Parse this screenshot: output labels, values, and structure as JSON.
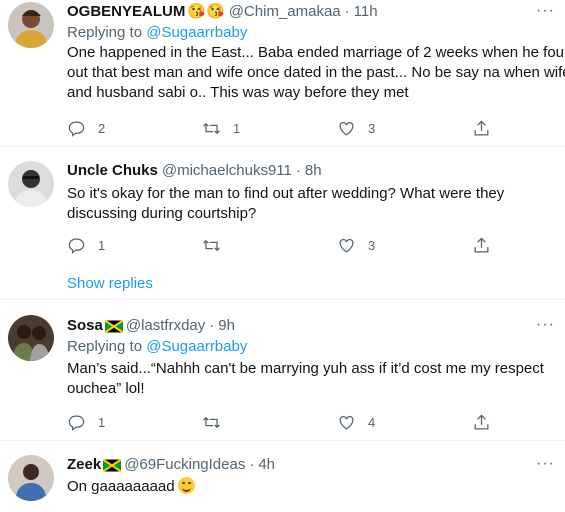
{
  "tweets": [
    {
      "name": "OGBENYEALUM",
      "name_emoji": "😘😘",
      "handle": "@Chim_amakaa",
      "time": "11h",
      "replying_label": "Replying to",
      "replying_to": "@Sugaarrbaby",
      "text_lines": [
        "One happened in the East... Baba ended marriage of 2 weeks when he found",
        "out that best man and wife once dated in the past... No be say na when wife",
        "and husband sabi o.. This was way before they met"
      ],
      "replies": "2",
      "retweets": "1",
      "likes": "3"
    },
    {
      "name": "Uncle Chuks",
      "handle": "@michaelchuks911",
      "time": "8h",
      "text_lines": [
        "So it's okay for the man to find out after wedding? What were they",
        "discussing during courtship?"
      ],
      "replies": "1",
      "retweets": "",
      "likes": "3",
      "show_replies": "Show replies"
    },
    {
      "name": "Sosa",
      "handle": "@lastfrxday",
      "time": "9h",
      "replying_label": "Replying to",
      "replying_to": "@Sugaarrbaby",
      "text_lines": [
        "Man’s said...“Nahhh can't be marrying yuh ass if it’d cost me my respect",
        "ouchea” lol!"
      ],
      "replies": "1",
      "retweets": "",
      "likes": "4"
    },
    {
      "name": "Zeek",
      "handle": "@69FuckingIdeas",
      "time": "4h",
      "text_lines": [
        "On gaaaaaaaad"
      ]
    }
  ],
  "colors": {
    "link": "#1d9bf0",
    "muted": "#536471",
    "text": "#0f1419"
  },
  "icons": [
    "reply-icon",
    "retweet-icon",
    "like-icon",
    "share-icon",
    "more-icon",
    "jamaica-flag-icon",
    "grinning-sweat-emoji-icon"
  ]
}
